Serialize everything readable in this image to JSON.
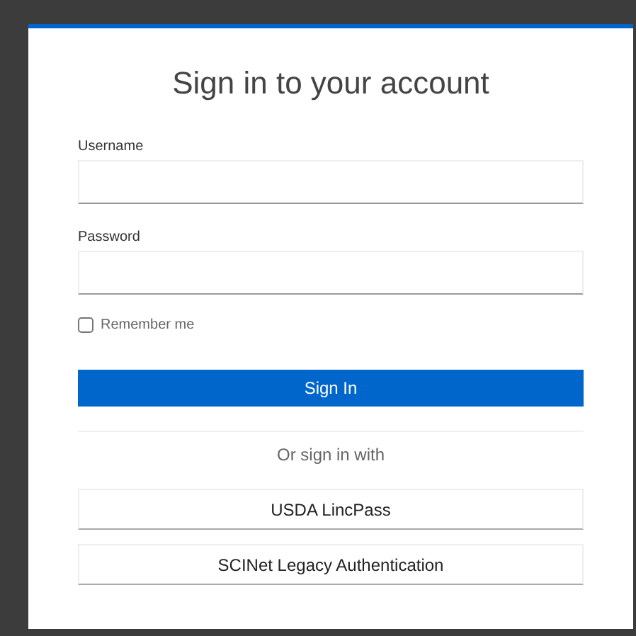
{
  "title": "Sign in to your account",
  "fields": [
    {
      "label": "Username"
    },
    {
      "label": "Password"
    }
  ],
  "remember": {
    "label": "Remember me",
    "checked": false
  },
  "submit": "Sign In",
  "divider_text": "Or sign in with",
  "providers": [
    "USDA LincPass",
    "SCINet Legacy Authentication"
  ]
}
